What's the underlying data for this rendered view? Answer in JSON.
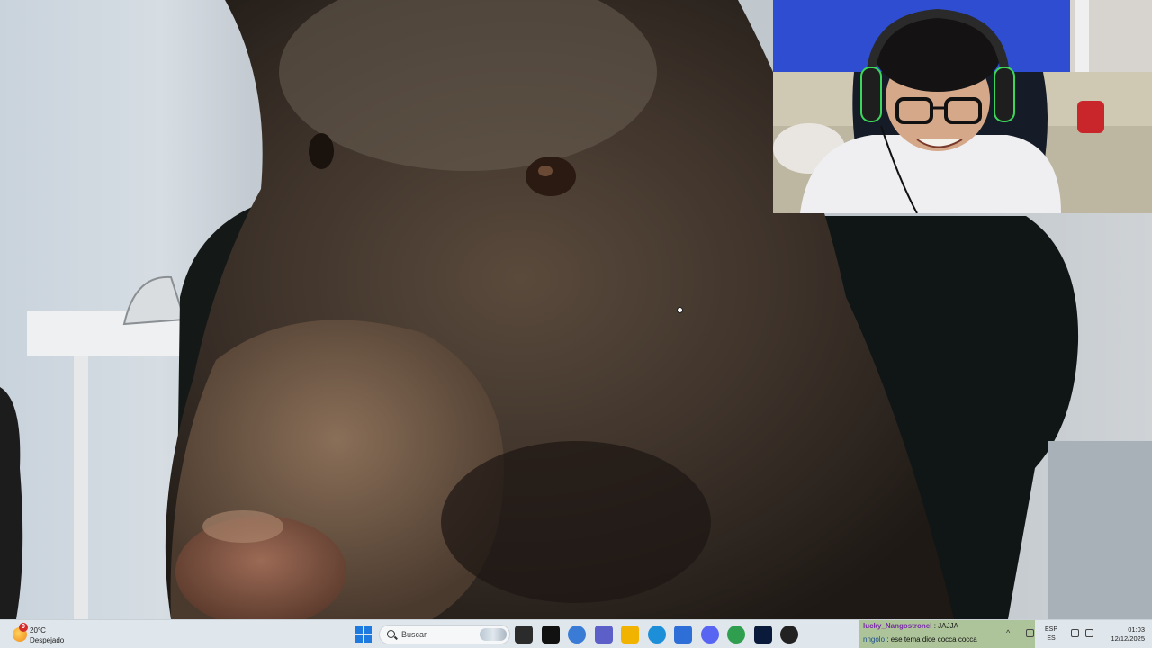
{
  "taskbar": {
    "weather": {
      "temperature": "20°C",
      "condition": "Despejado",
      "badge": "9"
    },
    "search": {
      "placeholder": "Buscar"
    },
    "apps": [
      {
        "name": "task-view-icon",
        "color": "#2b2b2b"
      },
      {
        "name": "capcut-icon",
        "color": "#111111"
      },
      {
        "name": "copilot-icon",
        "color": "#3a7bd5"
      },
      {
        "name": "teams-icon",
        "color": "#5b5fc7"
      },
      {
        "name": "file-explorer-icon",
        "color": "#f2b200"
      },
      {
        "name": "edge-icon",
        "color": "#1d8fd8"
      },
      {
        "name": "store-icon",
        "color": "#2d6fd6"
      },
      {
        "name": "discord-icon",
        "color": "#5865f2"
      },
      {
        "name": "chrome-icon",
        "color": "#2f9e4f"
      },
      {
        "name": "photoshop-icon",
        "color": "#0a1a3a"
      },
      {
        "name": "obs-icon",
        "color": "#222222"
      }
    ],
    "language": {
      "top": "ESP",
      "bottom": "ES"
    },
    "clock": {
      "time": "01:03",
      "date": "12/12/2025"
    }
  },
  "chat": [
    {
      "user": "lucky_Nangostronel",
      "message": "JAJJA"
    },
    {
      "user": "nngolo",
      "message": "ese tema dice cocca cocca"
    }
  ]
}
